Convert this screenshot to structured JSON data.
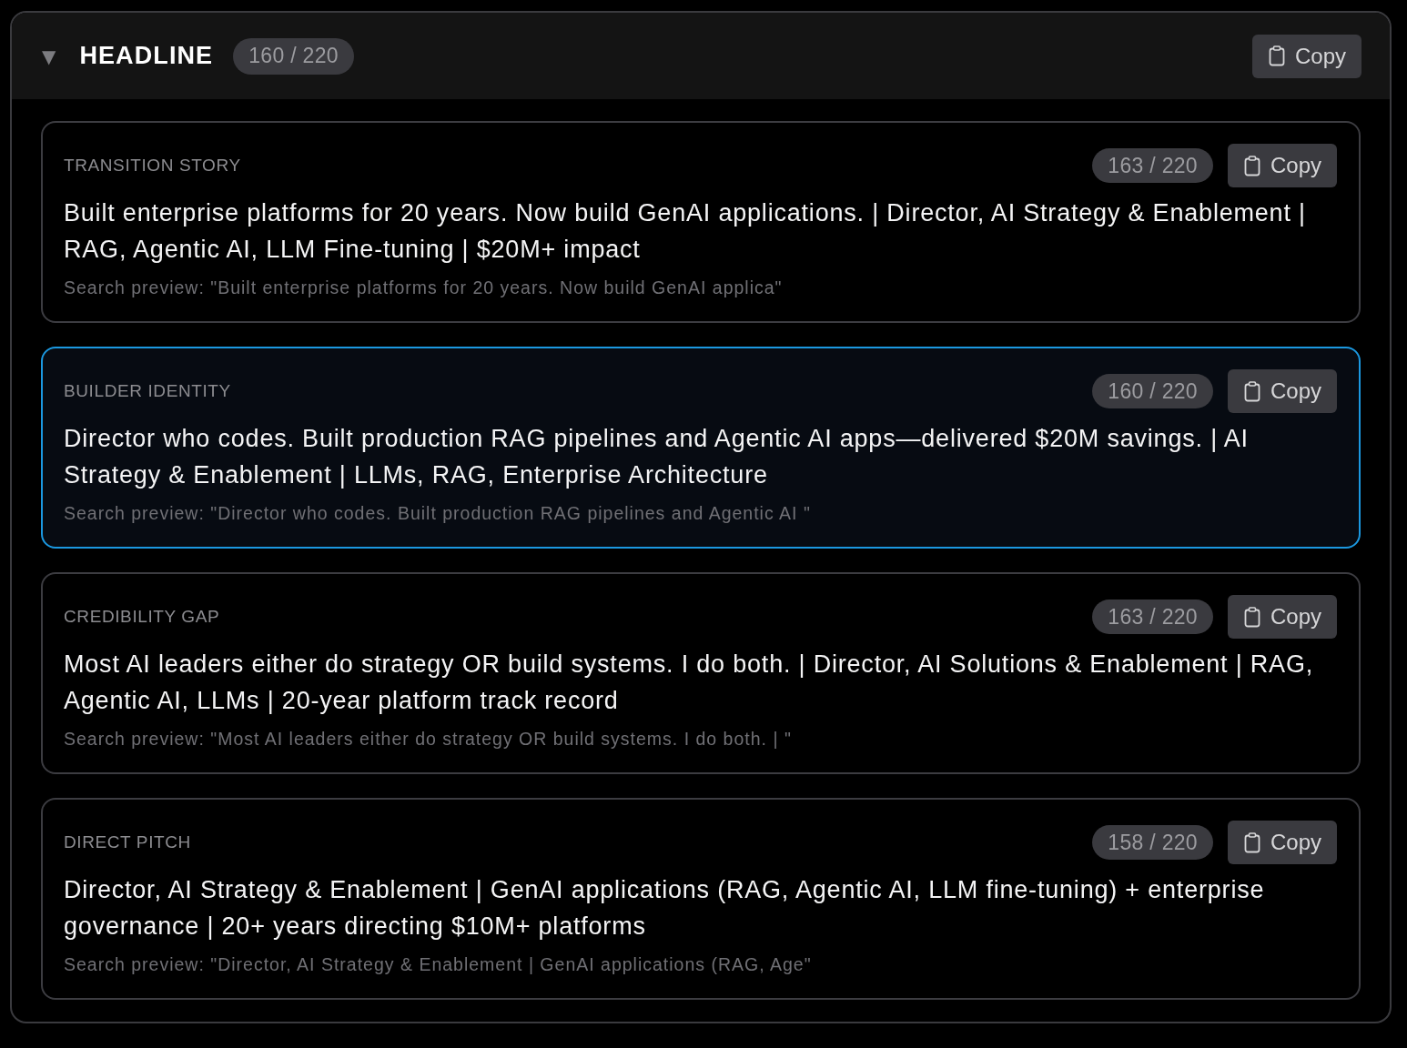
{
  "section": {
    "toggle": "▼",
    "expanded": true,
    "title": "HEADLINE",
    "count": "160 / 220",
    "copy_label": "Copy"
  },
  "variants": [
    {
      "label": "TRANSITION STORY",
      "count": "163 / 220",
      "copy_label": "Copy",
      "text": "Built enterprise platforms for 20 years. Now build GenAI applications. | Director, AI Strategy & Enablement | RAG, Agentic AI, LLM Fine-tuning | $20M+ impact",
      "preview": "Search preview: \"Built enterprise platforms for 20 years. Now build GenAI applica\"",
      "selected": false
    },
    {
      "label": "BUILDER IDENTITY",
      "count": "160 / 220",
      "copy_label": "Copy",
      "text": "Director who codes. Built production RAG pipelines and Agentic AI apps—delivered $20M savings. | AI Strategy & Enablement | LLMs, RAG, Enterprise Architecture",
      "preview": "Search preview: \"Director who codes. Built production RAG pipelines and Agentic AI \"",
      "selected": true
    },
    {
      "label": "CREDIBILITY GAP",
      "count": "163 / 220",
      "copy_label": "Copy",
      "text": "Most AI leaders either do strategy OR build systems. I do both. | Director, AI Solutions & Enablement | RAG, Agentic AI, LLMs | 20-year platform track record",
      "preview": "Search preview: \"Most AI leaders either do strategy OR build systems. I do both. | \"",
      "selected": false
    },
    {
      "label": "DIRECT PITCH",
      "count": "158 / 220",
      "copy_label": "Copy",
      "text": "Director, AI Strategy & Enablement | GenAI applications (RAG, Agentic AI, LLM fine-tuning) + enterprise governance | 20+ years directing $10M+ platforms",
      "preview": "Search preview: \"Director, AI Strategy & Enablement | GenAI applications (RAG, Age\"",
      "selected": false
    }
  ]
}
